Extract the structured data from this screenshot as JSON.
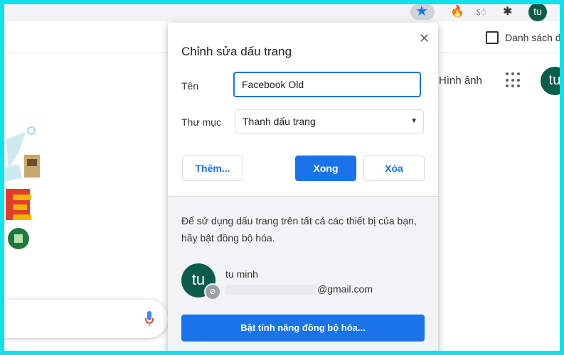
{
  "toolbar": {
    "star_icon": "star-icon",
    "extension_icons": [
      "flame-extension-icon",
      "translate-extension-icon",
      "puzzle-extension-icon"
    ],
    "avatar_letter": "tu"
  },
  "bookmarks_bar": {
    "reading_list_label": "Danh sách đ"
  },
  "page": {
    "images_link": "Hình ảnh",
    "avatar_letter": "tu"
  },
  "dialog": {
    "title": "Chỉnh sửa dấu trang",
    "name_label": "Tên",
    "name_value": "Facebook Old",
    "folder_label": "Thư mục",
    "folder_value": "Thanh dấu trang",
    "more_button": "Thêm...",
    "done_button": "Xong",
    "remove_button": "Xóa",
    "sync_text": "Để sử dụng dấu trang trên tất cả các thiết bị của bạn, hãy bật đồng bộ hóa.",
    "account": {
      "avatar_letter": "tu",
      "name": "tu minh",
      "email_suffix": "@gmail.com"
    },
    "sync_button": "Bật tính năng đồng bộ hóa..."
  },
  "colors": {
    "accent": "#1a73e8",
    "avatar": "#0d5c4b",
    "border": "#0fe3ea"
  }
}
